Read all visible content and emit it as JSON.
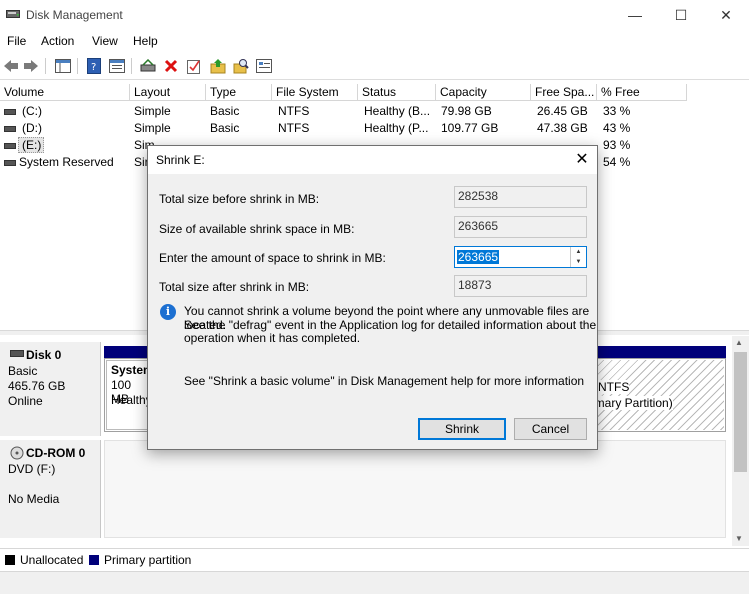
{
  "window": {
    "title": "Disk Management",
    "minimize_glyph": "—",
    "maximize_glyph": "☐",
    "close_glyph": "✕"
  },
  "menu": [
    "File",
    "Action",
    "View",
    "Help"
  ],
  "table": {
    "columns": [
      "Volume",
      "Layout",
      "Type",
      "File System",
      "Status",
      "Capacity",
      "Free Spa...",
      "% Free"
    ],
    "rows": [
      {
        "volume": "(C:)",
        "layout": "Simple",
        "type": "Basic",
        "fs": "NTFS",
        "status": "Healthy (B...",
        "capacity": "79.98 GB",
        "free": "26.45 GB",
        "pct": "33 %"
      },
      {
        "volume": "(D:)",
        "layout": "Simple",
        "type": "Basic",
        "fs": "NTFS",
        "status": "Healthy (P...",
        "capacity": "109.77 GB",
        "free": "47.38 GB",
        "pct": "43 %"
      },
      {
        "volume": "(E:)",
        "layout": "Sim",
        "type": "",
        "fs": "",
        "status": "",
        "capacity": "",
        "free": "",
        "pct": "93 %"
      },
      {
        "volume": "System Reserved",
        "layout": "Sir",
        "type": "",
        "fs": "",
        "status": "",
        "capacity": "",
        "free": "",
        "pct": "54 %"
      }
    ]
  },
  "disks": {
    "disk0": {
      "name": "Disk 0",
      "type": "Basic",
      "size": "465.76 GB",
      "state": "Online"
    },
    "cdrom": {
      "name": "CD-ROM 0",
      "type": "DVD (F:)",
      "state": "No Media"
    },
    "partition_left": {
      "line1": "System",
      "line2": "100 MB",
      "line3": "Healthy"
    },
    "partition_right": {
      "line1": "NTFS",
      "line2": "imary Partition)"
    }
  },
  "legend": {
    "unallocated": "Unallocated",
    "primary": "Primary partition"
  },
  "dialog": {
    "title": "Shrink E:",
    "total_before_label": "Total size before shrink in MB:",
    "total_before_value": "282538",
    "available_label": "Size of available shrink space in MB:",
    "available_value": "263665",
    "enter_label": "Enter the amount of space to shrink in MB:",
    "enter_value": "263665",
    "total_after_label": "Total size after shrink in MB:",
    "total_after_value": "18873",
    "info_line1": "You cannot shrink a volume beyond the point where any unmovable files are located.",
    "info_line2": "See the \"defrag\" event in the Application log for detailed information about the",
    "info_line3": "operation when it has completed.",
    "help_text": "See \"Shrink a basic volume\" in Disk Management help for more information",
    "shrink_label": "Shrink",
    "cancel_label": "Cancel",
    "close_glyph": "✕"
  },
  "colors": {
    "primary_partition": "#00007a",
    "accent": "#0078d7"
  }
}
